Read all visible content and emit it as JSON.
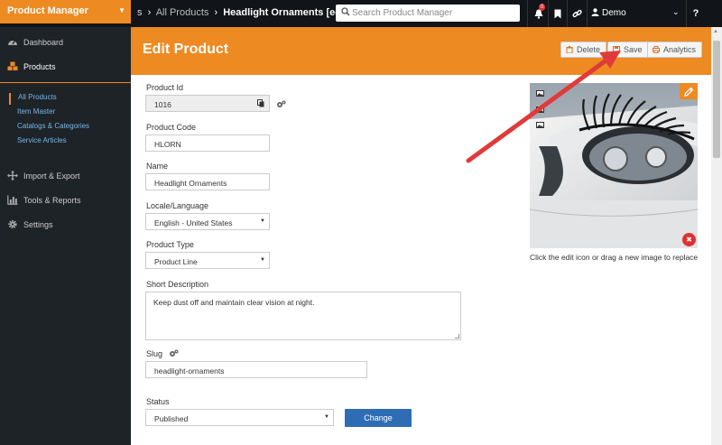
{
  "app": {
    "title": "Product Manager"
  },
  "breadcrumb": {
    "back": "s",
    "parent": "All Products",
    "current": "Headlight Ornaments [ed"
  },
  "search": {
    "placeholder": "Search Product Manager"
  },
  "notifications": {
    "count": "0"
  },
  "user": {
    "name": "Demo"
  },
  "sidebar": {
    "items": [
      {
        "label": "Dashboard",
        "icon": "dashboard-icon"
      },
      {
        "label": "Products",
        "icon": "products-icon"
      }
    ],
    "subitems": [
      {
        "label": "All Products"
      },
      {
        "label": "Item Master"
      },
      {
        "label": "Catalogs & Categories"
      },
      {
        "label": "Service Articles"
      }
    ],
    "items2": [
      {
        "label": "Import & Export",
        "icon": "move-icon"
      },
      {
        "label": "Tools & Reports",
        "icon": "bar-chart-icon"
      },
      {
        "label": "Settings",
        "icon": "gear-icon"
      }
    ]
  },
  "header": {
    "title": "Edit Product",
    "delete_label": "Delete",
    "save_label": "Save",
    "analytics_label": "Analytics"
  },
  "form": {
    "product_id": {
      "label": "Product Id",
      "value": "1016"
    },
    "product_code": {
      "label": "Product Code",
      "value": "HLORN"
    },
    "name": {
      "label": "Name",
      "value": "Headlight Ornaments"
    },
    "locale": {
      "label": "Locale/Language",
      "value": "English - United States"
    },
    "product_type": {
      "label": "Product Type",
      "value": "Product Line"
    },
    "short_description": {
      "label": "Short Description",
      "value": "Keep dust off and maintain clear vision at night."
    },
    "slug": {
      "label": "Slug",
      "value": "headlight-ornaments"
    },
    "status": {
      "label": "Status",
      "value": "Published"
    },
    "change_label": "Change"
  },
  "image": {
    "caption": "Click the edit icon or drag a new image to replace"
  },
  "colors": {
    "accent": "#ee8a22",
    "sidebar": "#1e2327",
    "topbar": "#111418",
    "primary_button": "#2e6db4",
    "annotation_arrow": "#e03a3a"
  }
}
